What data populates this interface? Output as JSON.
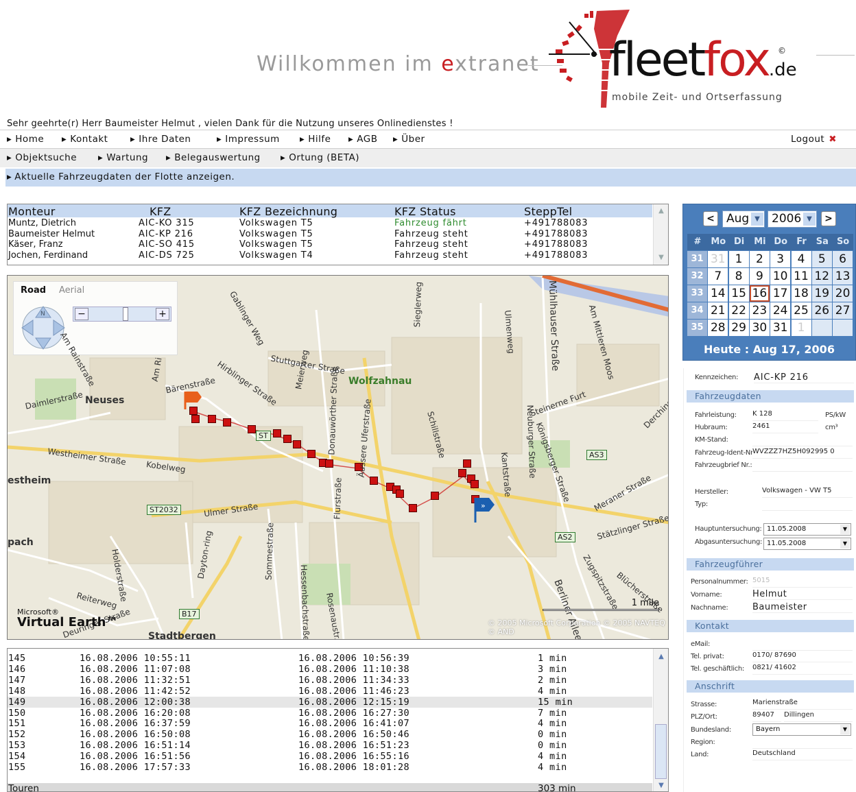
{
  "header": {
    "welcome_pre": "Willkommen im ",
    "welcome_accent": "e",
    "welcome_post": "xtranet",
    "brand_a": "fleet",
    "brand_b": "fox",
    "brand_c": ".de",
    "brand_copy": "©",
    "tagline": "mobile Zeit- und Ortserfassung",
    "greeting": "Sehr geehrte(r) Herr Baumeister Helmut  , vielen Dank für die Nutzung unseres Onlinedienstes !"
  },
  "nav_main": [
    "Home",
    "Kontakt",
    "Ihre Daten",
    "Impressum",
    "Hilfe",
    "AGB",
    "Über"
  ],
  "logout_label": "Logout",
  "nav_secondary": [
    "Objektsuche",
    "Wartung",
    "Belegauswertung",
    "Ortung (BETA)"
  ],
  "banner": "Aktuelle Fahrzeugdaten der Flotte anzeigen.",
  "vehicles": {
    "headers": [
      "Monteur",
      "KFZ",
      "KFZ Bezeichnung",
      "KFZ Status",
      "SteppTel"
    ],
    "rows": [
      [
        "Muntz, Dietrich",
        "AIC-KO 315",
        "Volkswagen T5",
        "Fahrzeug fährt",
        "+491788083"
      ],
      [
        "Baumeister Helmut",
        "AIC-KP 216",
        "Volkswagen T5",
        "Fahrzeug steht",
        "+491788083"
      ],
      [
        "Käser, Franz",
        "AIC-SO 415",
        "Volkswagen T5",
        "Fahrzeug steht",
        "+491788083"
      ],
      [
        "Jochen, Ferdinand",
        "AIC-DS 725",
        "Volkswagen T4",
        "Fahrzeug steht",
        "+491788083"
      ]
    ],
    "status_colors": {
      "moving": "#2e8b2e",
      "stopped": "#111111"
    }
  },
  "map": {
    "tab_road": "Road",
    "tab_aerial": "Aerial",
    "places": [
      "Neuses",
      "Wolfzahnau",
      "estheim",
      "pach",
      "Stadtbergen"
    ],
    "streets": [
      "Bärenstraße",
      "Hirblinger Straße",
      "Stuttgarter Straße",
      "Westheimer Straße",
      "Kobelweg",
      "Ulmer Straße",
      "Dayton-ring",
      "Sommestraße",
      "Hessenbachstraße",
      "Rosenaustr.",
      "Holderstraße",
      "Reiterweg",
      "Deuringer Straße",
      "Flurstraße",
      "Donauwörther Straße",
      "Äussere Uferstraße",
      "Meierweg",
      "Schillstraße",
      "Neuburger Straße",
      "Ulmenweg",
      "Mühlhauser Straße",
      "Am Mittleren Moos",
      "Steinerne Furt",
      "Kantstraße",
      "Königsberger Straße",
      "Meraner Straße",
      "Stätzlinger Straße",
      "Zugspitzstraße",
      "Berliner Allee",
      "Blücherstraße",
      "Derchinger",
      "Sieglerweg",
      "Gablinger Weg",
      "Am Ri",
      "Daimlerstraße",
      "Am Rainstraße"
    ],
    "shields": [
      "ST2032",
      "B17",
      "AS2",
      "AS3",
      "ST"
    ],
    "scale": "1 mile",
    "ms_logo": "Microsoft®",
    "ve_logo": "Virtual Earth™",
    "copyright": "© 2005 Microsoft Corporation   © 2005 NAVTEQ   © AND",
    "route_color": "#cc1111"
  },
  "log": {
    "rows": [
      [
        "145",
        "16.08.2006 10:55:11",
        "16.08.2006 10:56:39",
        "1 min"
      ],
      [
        "146",
        "16.08.2006 11:07:08",
        "16.08.2006 11:10:38",
        "3 min"
      ],
      [
        "147",
        "16.08.2006 11:32:51",
        "16.08.2006 11:34:33",
        "2 min"
      ],
      [
        "148",
        "16.08.2006 11:42:52",
        "16.08.2006 11:46:23",
        "4 min"
      ],
      [
        "149",
        "16.08.2006 12:00:38",
        "16.08.2006 12:15:19",
        "15 min"
      ],
      [
        "150",
        "16.08.2006 16:20:08",
        "16.08.2006 16:27:30",
        "7 min"
      ],
      [
        "151",
        "16.08.2006 16:37:59",
        "16.08.2006 16:41:07",
        "4 min"
      ],
      [
        "152",
        "16.08.2006 16:50:08",
        "16.08.2006 16:50:46",
        "0 min"
      ],
      [
        "153",
        "16.08.2006 16:51:14",
        "16.08.2006 16:51:23",
        "0 min"
      ],
      [
        "154",
        "16.08.2006 16:51:56",
        "16.08.2006 16:55:16",
        "4 min"
      ],
      [
        "155",
        "16.08.2006 17:57:33",
        "16.08.2006 18:01:28",
        "4 min"
      ]
    ],
    "total_label": "Touren",
    "total_value": "303 min"
  },
  "calendar": {
    "month": "Aug",
    "year": "2006",
    "prev": "<",
    "next": ">",
    "weekday_header": [
      "#",
      "Mo",
      "Di",
      "Mi",
      "Do",
      "Fr",
      "Sa",
      "So"
    ],
    "weeks": [
      {
        "wk": "31",
        "days": [
          "31",
          "1",
          "2",
          "3",
          "4",
          "5",
          "6"
        ]
      },
      {
        "wk": "32",
        "days": [
          "7",
          "8",
          "9",
          "10",
          "11",
          "12",
          "13"
        ]
      },
      {
        "wk": "33",
        "days": [
          "14",
          "15",
          "16",
          "17",
          "18",
          "19",
          "20"
        ]
      },
      {
        "wk": "34",
        "days": [
          "21",
          "22",
          "23",
          "24",
          "25",
          "26",
          "27"
        ]
      },
      {
        "wk": "35",
        "days": [
          "28",
          "29",
          "30",
          "31",
          "1",
          "",
          ""
        ]
      }
    ],
    "today": "Heute : Aug 17, 2006"
  },
  "detail": {
    "kennzeichen_label": "Kennzeichen:",
    "kennzeichen": "AIC-KP 216",
    "sec_fahrzeug": "Fahrzeugdaten",
    "fahrleistung_label": "Fahrleistung:",
    "fahrleistung": "K 128",
    "fahrleistung_unit": "PS/kW",
    "hubraum_label": "Hubraum:",
    "hubraum": "2461",
    "hubraum_unit": "cm³",
    "km_label": "KM-Stand:",
    "ident_label": "Fahrzeug-Ident-Nr.:",
    "ident": "WVZZZ7HZ5H092995 0",
    "brief_label": "Fahrzeugbrief Nr.:",
    "hersteller_label": "Hersteller:",
    "hersteller": "Volkswagen - VW T5",
    "typ_label": "Typ:",
    "hu_label": "Hauptuntersuchung:",
    "hu": "11.05.2008",
    "au_label": "Abgasuntersuchung:",
    "au": "11.05.2008",
    "sec_fuehrer": "Fahrzeugführer",
    "personal_label": "Personalnummer:",
    "personal": "5015",
    "vorname_label": "Vorname:",
    "vorname": "Helmut",
    "nachname_label": "Nachname:",
    "nachname": "Baumeister",
    "sec_kontakt": "Kontakt",
    "email_label": "eMail:",
    "tel_privat_label": "Tel. privat:",
    "tel_privat": "0170/ 87690",
    "tel_gesch_label": "Tel. geschäftlich:",
    "tel_gesch": "0821/ 41602",
    "sec_anschrift": "Anschrift",
    "strasse_label": "Strasse:",
    "strasse": "Marienstraße",
    "plz_label": "PLZ/Ort:",
    "plz": "89407",
    "ort": "Dillingen",
    "bundesland_label": "Bundesland:",
    "bundesland": "Bayern",
    "region_label": "Region:",
    "land_label": "Land:",
    "land": "Deutschland"
  }
}
